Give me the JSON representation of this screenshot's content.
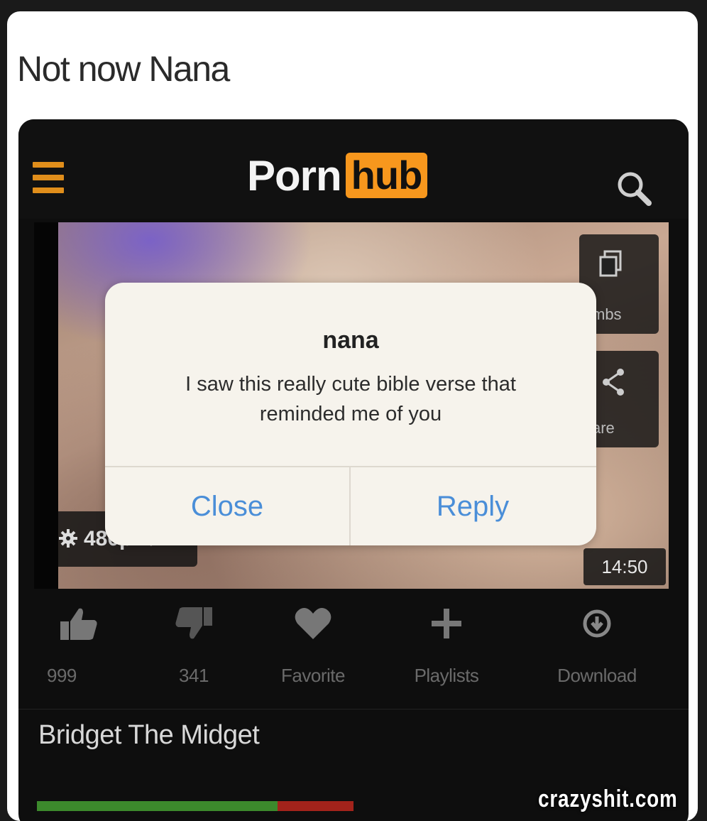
{
  "post": {
    "caption": "Not now Nana"
  },
  "site": {
    "logo_left": "Porn",
    "logo_right": "hub",
    "accent_color": "#f7971d"
  },
  "player": {
    "quality": "480p",
    "duration": "14:50",
    "side_buttons": [
      {
        "label": "mbs",
        "icon": "thumbnails-icon"
      },
      {
        "label": "are",
        "icon": "share-icon"
      }
    ]
  },
  "actions": [
    {
      "label": "999",
      "icon": "thumbs-up-icon"
    },
    {
      "label": "341",
      "icon": "thumbs-down-icon"
    },
    {
      "label": "Favorite",
      "icon": "heart-icon"
    },
    {
      "label": "Playlists",
      "icon": "plus-icon"
    },
    {
      "label": "Download",
      "icon": "download-icon"
    }
  ],
  "video": {
    "title": "Bridget The Midget",
    "rating_fraction": 0.76
  },
  "alert": {
    "title": "nana",
    "message": "I saw this really cute bible verse that reminded me of you",
    "close_label": "Close",
    "reply_label": "Reply",
    "button_color": "#4a8ed8"
  },
  "watermark": "crazyshit.com"
}
